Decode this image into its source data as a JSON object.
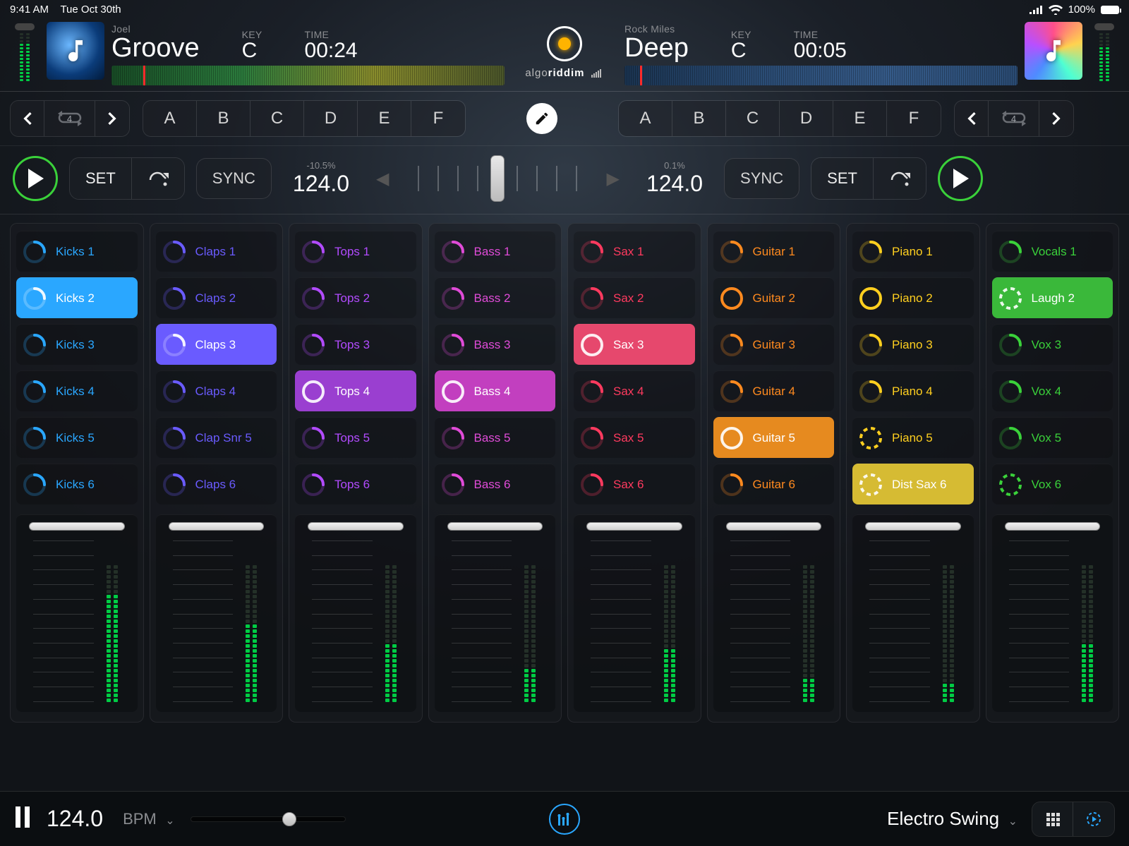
{
  "status": {
    "time": "9:41 AM",
    "date": "Tue Oct 30th",
    "battery": "100%"
  },
  "brand": {
    "left": "algo",
    "right": "riddim"
  },
  "deck_a": {
    "artist": "Joel",
    "title": "Groove",
    "key_lbl": "KEY",
    "key": "C",
    "time_lbl": "TIME",
    "time": "00:24",
    "playhead_pct": 8
  },
  "deck_b": {
    "artist": "Rock Miles",
    "title": "Deep",
    "key_lbl": "KEY",
    "key": "C",
    "time_lbl": "TIME",
    "time": "00:05",
    "playhead_pct": 4
  },
  "cues": {
    "letters": [
      "A",
      "B",
      "C",
      "D",
      "E",
      "F"
    ],
    "loop": "4"
  },
  "transport": {
    "set": "SET",
    "sync": "SYNC",
    "a_pct": "-10.5%",
    "a_bpm": "124.0",
    "b_pct": "0.1%",
    "b_bpm": "124.0"
  },
  "colors": {
    "kicks": "#2aa7ff",
    "claps": "#6a5bff",
    "tops": "#b24bff",
    "bass": "#e04bd8",
    "bass_alt": "#ff3fa8",
    "sax": "#ff3a5f",
    "guitar": "#ff8a1f",
    "piano": "#ffcf1f",
    "vox": "#3ad13a"
  },
  "channels": [
    {
      "color": "kicks",
      "clips": [
        {
          "label": "Kicks 1",
          "style": "partial"
        },
        {
          "label": "Kicks 2",
          "style": "partial",
          "active": true,
          "bg": "#2aa7ff"
        },
        {
          "label": "Kicks 3",
          "style": "partial"
        },
        {
          "label": "Kicks 4",
          "style": "partial"
        },
        {
          "label": "Kicks 5",
          "style": "partial"
        },
        {
          "label": "Kicks 6",
          "style": "partial"
        }
      ],
      "vu": 0.78
    },
    {
      "color": "claps",
      "clips": [
        {
          "label": "Claps 1",
          "style": "partial"
        },
        {
          "label": "Claps 2",
          "style": "partial"
        },
        {
          "label": "Claps 3",
          "style": "partial",
          "active": true,
          "bg": "#6a5bff"
        },
        {
          "label": "Claps 4",
          "style": "partial"
        },
        {
          "label": "Clap Snr 5",
          "style": "partial"
        },
        {
          "label": "Claps 6",
          "style": "partial"
        }
      ],
      "vu": 0.55
    },
    {
      "color": "tops",
      "clips": [
        {
          "label": "Tops 1",
          "style": "partial"
        },
        {
          "label": "Tops 2",
          "style": "partial"
        },
        {
          "label": "Tops 3",
          "style": "partial"
        },
        {
          "label": "Tops 4",
          "style": "solid",
          "active": true,
          "bg": "#9a3fd0"
        },
        {
          "label": "Tops 5",
          "style": "partial"
        },
        {
          "label": "Tops 6",
          "style": "partial"
        }
      ],
      "vu": 0.4
    },
    {
      "color": "bass",
      "clips": [
        {
          "label": "Bass 1",
          "style": "partial"
        },
        {
          "label": "Bass 2",
          "style": "partial"
        },
        {
          "label": "Bass 3",
          "style": "partial"
        },
        {
          "label": "Bass 4",
          "style": "solid",
          "active": true,
          "bg": "#c23fbf"
        },
        {
          "label": "Bass 5",
          "style": "partial"
        },
        {
          "label": "Bass 6",
          "style": "partial"
        }
      ],
      "vu": 0.22
    },
    {
      "color": "sax",
      "clips": [
        {
          "label": "Sax 1",
          "style": "partial"
        },
        {
          "label": "Sax 2",
          "style": "partial"
        },
        {
          "label": "Sax 3",
          "style": "solid",
          "active": true,
          "bg": "#e6486d"
        },
        {
          "label": "Sax 4",
          "style": "partial"
        },
        {
          "label": "Sax 5",
          "style": "partial"
        },
        {
          "label": "Sax 6",
          "style": "partial"
        }
      ],
      "vu": 0.36
    },
    {
      "color": "guitar",
      "clips": [
        {
          "label": "Guitar 1",
          "style": "partial"
        },
        {
          "label": "Guitar 2",
          "style": "solid"
        },
        {
          "label": "Guitar 3",
          "style": "partial"
        },
        {
          "label": "Guitar 4",
          "style": "partial"
        },
        {
          "label": "Guitar 5",
          "style": "solid",
          "active": true,
          "bg": "#e68a1f"
        },
        {
          "label": "Guitar 6",
          "style": "partial"
        }
      ],
      "vu": 0.15
    },
    {
      "color": "piano",
      "clips": [
        {
          "label": "Piano 1",
          "style": "partial"
        },
        {
          "label": "Piano 2",
          "style": "solid"
        },
        {
          "label": "Piano 3",
          "style": "partial"
        },
        {
          "label": "Piano 4",
          "style": "partial"
        },
        {
          "label": "Piano 5",
          "style": "dashed"
        },
        {
          "label": "Dist Sax 6",
          "style": "dashed",
          "active": true,
          "bg": "#d6bb33"
        }
      ],
      "vu": 0.12
    },
    {
      "color": "vox",
      "clips": [
        {
          "label": "Vocals 1",
          "style": "partial"
        },
        {
          "label": "Laugh 2",
          "style": "dashed",
          "active": true,
          "bg": "#3ab83a"
        },
        {
          "label": "Vox 3",
          "style": "partial"
        },
        {
          "label": "Vox 4",
          "style": "partial"
        },
        {
          "label": "Vox 5",
          "style": "partial"
        },
        {
          "label": "Vox 6",
          "style": "dashed"
        }
      ],
      "vu": 0.42
    }
  ],
  "footer": {
    "bpm": "124.0",
    "bpm_lbl": "BPM",
    "preset": "Electro Swing",
    "slider_pos": 0.65
  }
}
